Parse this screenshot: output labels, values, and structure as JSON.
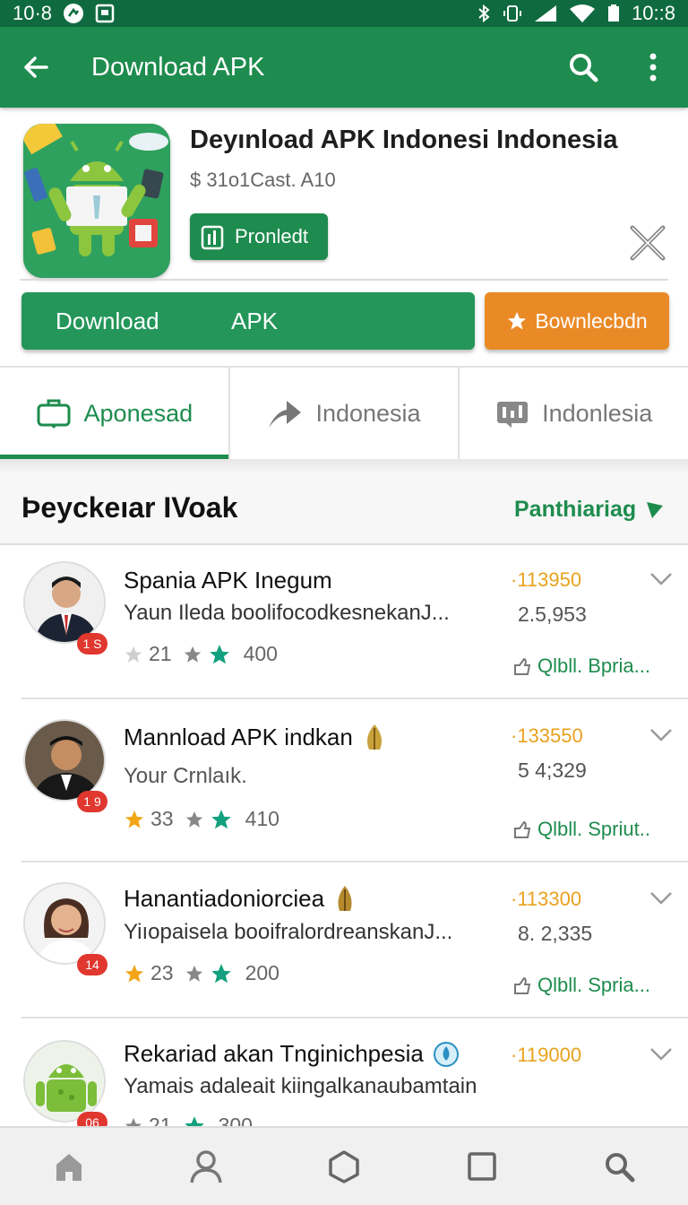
{
  "status_bar": {
    "time_left": "10·8",
    "time_right": "10::8"
  },
  "app_bar": {
    "title": "Download APK"
  },
  "app": {
    "title": "Deyınload APK Indonesi Indonesia",
    "price": "$ 31o1Cast. A10",
    "badge_label": "Pronledt"
  },
  "buttons": {
    "download_left": "Download",
    "download_right": "APK",
    "secondary": "Bownlecbdn"
  },
  "tabs": [
    {
      "label": "Aponesad",
      "icon": "briefcase-icon",
      "active": true
    },
    {
      "label": "Indonesia",
      "icon": "send-icon",
      "active": false
    },
    {
      "label": "Indonlesia",
      "icon": "chart-icon",
      "active": false
    }
  ],
  "section": {
    "heading": "Þeyckeıar IVoak",
    "link": "Panthiariag"
  },
  "list": [
    {
      "title": "Spania APK Inegum",
      "subtitle": "Yaun Ileda boolifocodkesnekanJ...",
      "badge": "1 S",
      "rating": "21",
      "count": "400",
      "num1": "·113950",
      "num2": "2.5,953",
      "link": "Qlbll. Bpria...",
      "avatar": "man-in-suit",
      "title_icon": ""
    },
    {
      "title": "Mannload APK indkan",
      "subtitle": "Your Crnlaık.",
      "badge": "1 9",
      "rating": "33",
      "count": "410",
      "num1": "·133550",
      "num2": "5 4;329",
      "link": "Qlbll. Spriut..",
      "avatar": "man-in-cap",
      "title_icon": "gold-leaf-icon"
    },
    {
      "title": "Hanantiadoniorciea",
      "subtitle": "Yiıopaisela booifralordreanskanJ...",
      "badge": "14",
      "rating": "23",
      "count": "200",
      "num1": "·113300",
      "num2": "8. 2,335",
      "link": "Qlbll. Spria...",
      "avatar": "woman",
      "title_icon": "gold-leaf-icon"
    },
    {
      "title": "Rekariad akan Tnginichpesia",
      "subtitle": "Yamais adaleait kiingalkanaubamtain",
      "badge": "06",
      "rating": "21",
      "count": "300",
      "num1": "·119000",
      "num2": "",
      "link": "",
      "avatar": "android-robot",
      "title_icon": "water-drop-icon"
    }
  ],
  "bottom_nav": [
    {
      "icon": "home-icon"
    },
    {
      "icon": "profile-icon"
    },
    {
      "icon": "hexagon-icon"
    },
    {
      "icon": "square-icon"
    },
    {
      "icon": "search-icon"
    }
  ],
  "colors": {
    "primary": "#1e8c4e",
    "status_bar": "#0f6b3f",
    "accent": "#ea8a26",
    "rating_gold": "#e8a21e",
    "badge_red": "#e0372f"
  }
}
